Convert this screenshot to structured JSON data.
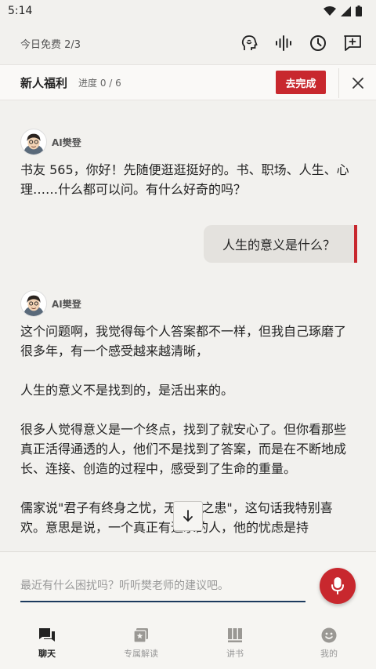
{
  "status_bar": {
    "time": "5:14"
  },
  "top_bar": {
    "free_count": "今日免费 2/3",
    "icons": [
      "listen-head-icon",
      "voice-wave-icon",
      "history-clock-icon",
      "new-chat-icon"
    ]
  },
  "welfare": {
    "title": "新人福利",
    "progress": "进度 0 / 6",
    "button_label": "去完成"
  },
  "chat": {
    "bot_name": "AI樊登",
    "messages": [
      {
        "role": "bot",
        "paragraphs": [
          "书友 565，你好！先随便逛逛挺好的。书、职场、人生、心理……什么都可以问。有什么好奇的吗？"
        ]
      },
      {
        "role": "user",
        "text": "人生的意义是什么？"
      },
      {
        "role": "bot",
        "paragraphs": [
          "这个问题啊，我觉得每个人答案都不一样，但我自己琢磨了很多年，有一个感受越来越清晰，",
          "人生的意义不是找到的，是活出来的。",
          "很多人觉得意义是一个终点，找到了就安心了。但你看那些真正活得通透的人，他们不是找到了答案，而是在不断地成长、连接、创造的过程中，感受到了生命的重量。",
          "儒家说\"君子有终身之忧，无一朝之患\"，这句话我特别喜欢。意思是说，一个真正有追求的人，他的忧虑是持"
        ]
      }
    ]
  },
  "input": {
    "placeholder": "最近有什么困扰吗？听听樊老师的建议吧。",
    "value": ""
  },
  "bottom_nav": {
    "items": [
      {
        "label": "聊天",
        "icon": "chat-icon",
        "active": true
      },
      {
        "label": "专属解读",
        "icon": "star-book-icon",
        "active": false
      },
      {
        "label": "讲书",
        "icon": "bookshelf-icon",
        "active": false
      },
      {
        "label": "我的",
        "icon": "smiley-icon",
        "active": false
      }
    ]
  },
  "colors": {
    "accent": "#c8282e",
    "background": "#f2f1ee",
    "input_underline": "#1c3a5e"
  }
}
